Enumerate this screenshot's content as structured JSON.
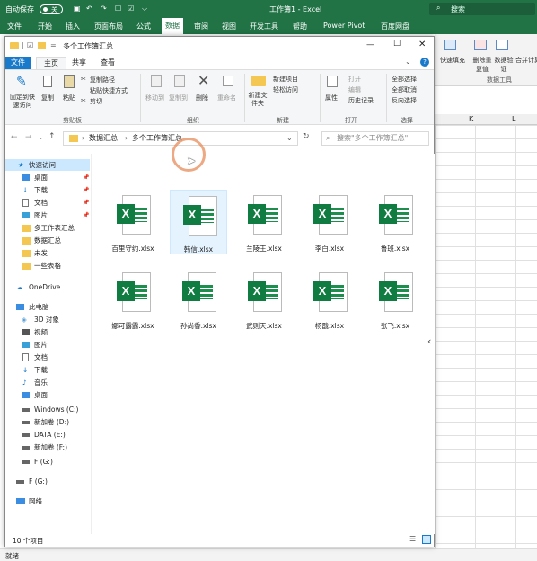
{
  "excel": {
    "autosave_label": "自动保存",
    "toggle_state": "关",
    "title": "工作簿1 - Excel",
    "search_placeholder": "搜索",
    "menu": [
      "文件",
      "开始",
      "插入",
      "页面布局",
      "公式",
      "数据",
      "审阅",
      "视图",
      "开发工具",
      "帮助",
      "Power Pivot",
      "百度网盘"
    ],
    "active_menu": "数据",
    "ribbon_partial": {
      "fill": "快速填充",
      "remove_dup": "删除重复值",
      "validate": "数据验证",
      "merge": "合并计算",
      "group_label": "数据工具"
    },
    "columns": [
      "K",
      "L"
    ],
    "status_left": "就绪",
    "accent": "#217346"
  },
  "explorer": {
    "title": "多个工作簿汇总",
    "tabs": {
      "file": "文件",
      "home": "主页",
      "share": "共享",
      "view": "查看"
    },
    "ribbon": {
      "pin": "固定到快速访问",
      "copy": "复制",
      "paste": "粘贴",
      "cut": "剪切",
      "copy_path": "复制路径",
      "paste_shortcut": "粘贴快捷方式",
      "clipboard": "剪贴板",
      "move_to": "移动到",
      "copy_to": "复制到",
      "delete": "删除",
      "rename": "重命名",
      "organize": "组织",
      "new_folder": "新建文件夹",
      "new_item": "新建项目",
      "easy_access": "轻松访问",
      "new": "新建",
      "properties": "属性",
      "open": "打开",
      "edit": "编辑",
      "history": "历史记录",
      "open_group": "打开",
      "select_all": "全部选择",
      "select_none": "全部取消",
      "invert": "反向选择",
      "select_group": "选择"
    },
    "address": {
      "root": "数据汇总",
      "current": "多个工作簿汇总"
    },
    "search_placeholder": "搜索\"多个工作簿汇总\"",
    "nav": {
      "quick_access": "快速访问",
      "desktop": "桌面",
      "downloads": "下载",
      "documents": "文档",
      "pictures": "图片",
      "folder1": "多工作表汇总",
      "folder2": "数据汇总",
      "folder3": "未发",
      "folder4": "一些表格",
      "onedrive": "OneDrive",
      "this_pc": "此电脑",
      "objects3d": "3D 对象",
      "videos": "视频",
      "pc_pictures": "图片",
      "pc_documents": "文档",
      "pc_downloads": "下载",
      "music": "音乐",
      "pc_desktop": "桌面",
      "drive_c": "Windows (C:)",
      "drive_d": "新加卷 (D:)",
      "drive_e": "DATA (E:)",
      "drive_f": "新加卷 (F:)",
      "drive_g1": "F (G:)",
      "drive_g2": "F (G:)",
      "network": "网络"
    },
    "files": [
      "百里守约.xlsx",
      "韩信.xlsx",
      "兰陵王.xlsx",
      "李白.xlsx",
      "鲁班.xlsx",
      "娜可露露.xlsx",
      "孙尚香.xlsx",
      "武则天.xlsx",
      "杨戬.xlsx",
      "张飞.xlsx"
    ],
    "status": "10 个项目",
    "excel_green": "#107c41"
  }
}
